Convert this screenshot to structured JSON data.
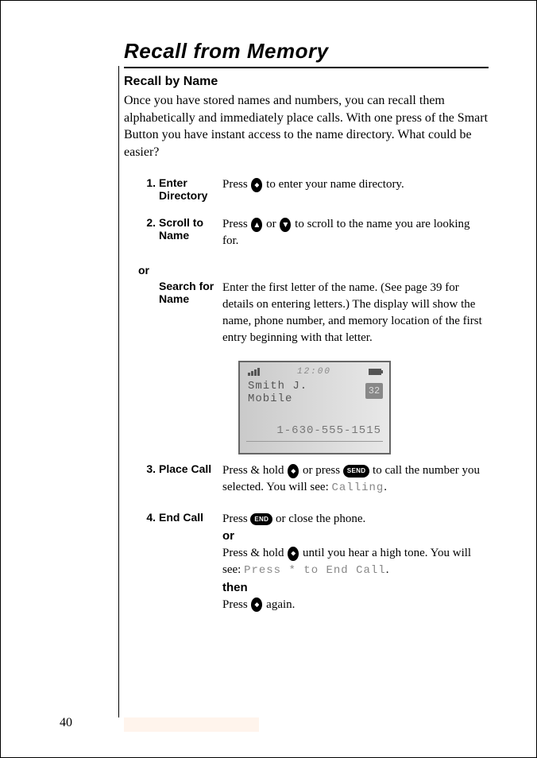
{
  "title": "Recall from Memory",
  "subtitle": "Recall by Name",
  "intro": "Once you have stored names and numbers, you can recall them alphabetically and immediately place calls. With one press of the Smart Button you have instant access to the name directory. What could be easier?",
  "steps": {
    "s1": {
      "num": "1.",
      "label": "Enter Directory",
      "desc_a": "Press ",
      "desc_b": " to enter your name directory."
    },
    "s2": {
      "num": "2.",
      "label": "Scroll to Name",
      "desc_a": "Press ",
      "desc_or": " or ",
      "desc_b": " to scroll to the name you are looking for."
    },
    "or_label": "or",
    "s2b": {
      "label": "Search for Name",
      "desc": "Enter the first letter of the name. (See page 39 for details on entering letters.) The display will show the name, phone number, and memory location of the first entry beginning with that letter."
    },
    "s3": {
      "num": "3.",
      "label": "Place Call",
      "desc_a": "Press & hold ",
      "desc_b": " or press ",
      "desc_c": " to call the number you selected. You will see: ",
      "lcd": "Calling",
      "desc_d": "."
    },
    "s4": {
      "num": "4.",
      "label": "End Call",
      "desc_a": "Press ",
      "desc_b": " or close the phone.",
      "or": "or",
      "desc_c": "Press & hold ",
      "desc_d": " until you hear a high tone. You will see: ",
      "lcd": "Press * to End Call",
      "desc_e": ".",
      "then": "then",
      "desc_f": "Press ",
      "desc_g": " again."
    }
  },
  "buttons": {
    "send": "SEND",
    "end": "END"
  },
  "phone": {
    "time": "12:00",
    "name": "Smith J.",
    "type": "Mobile",
    "memloc": "32",
    "number": "1-630-555-1515"
  },
  "page_number": "40"
}
